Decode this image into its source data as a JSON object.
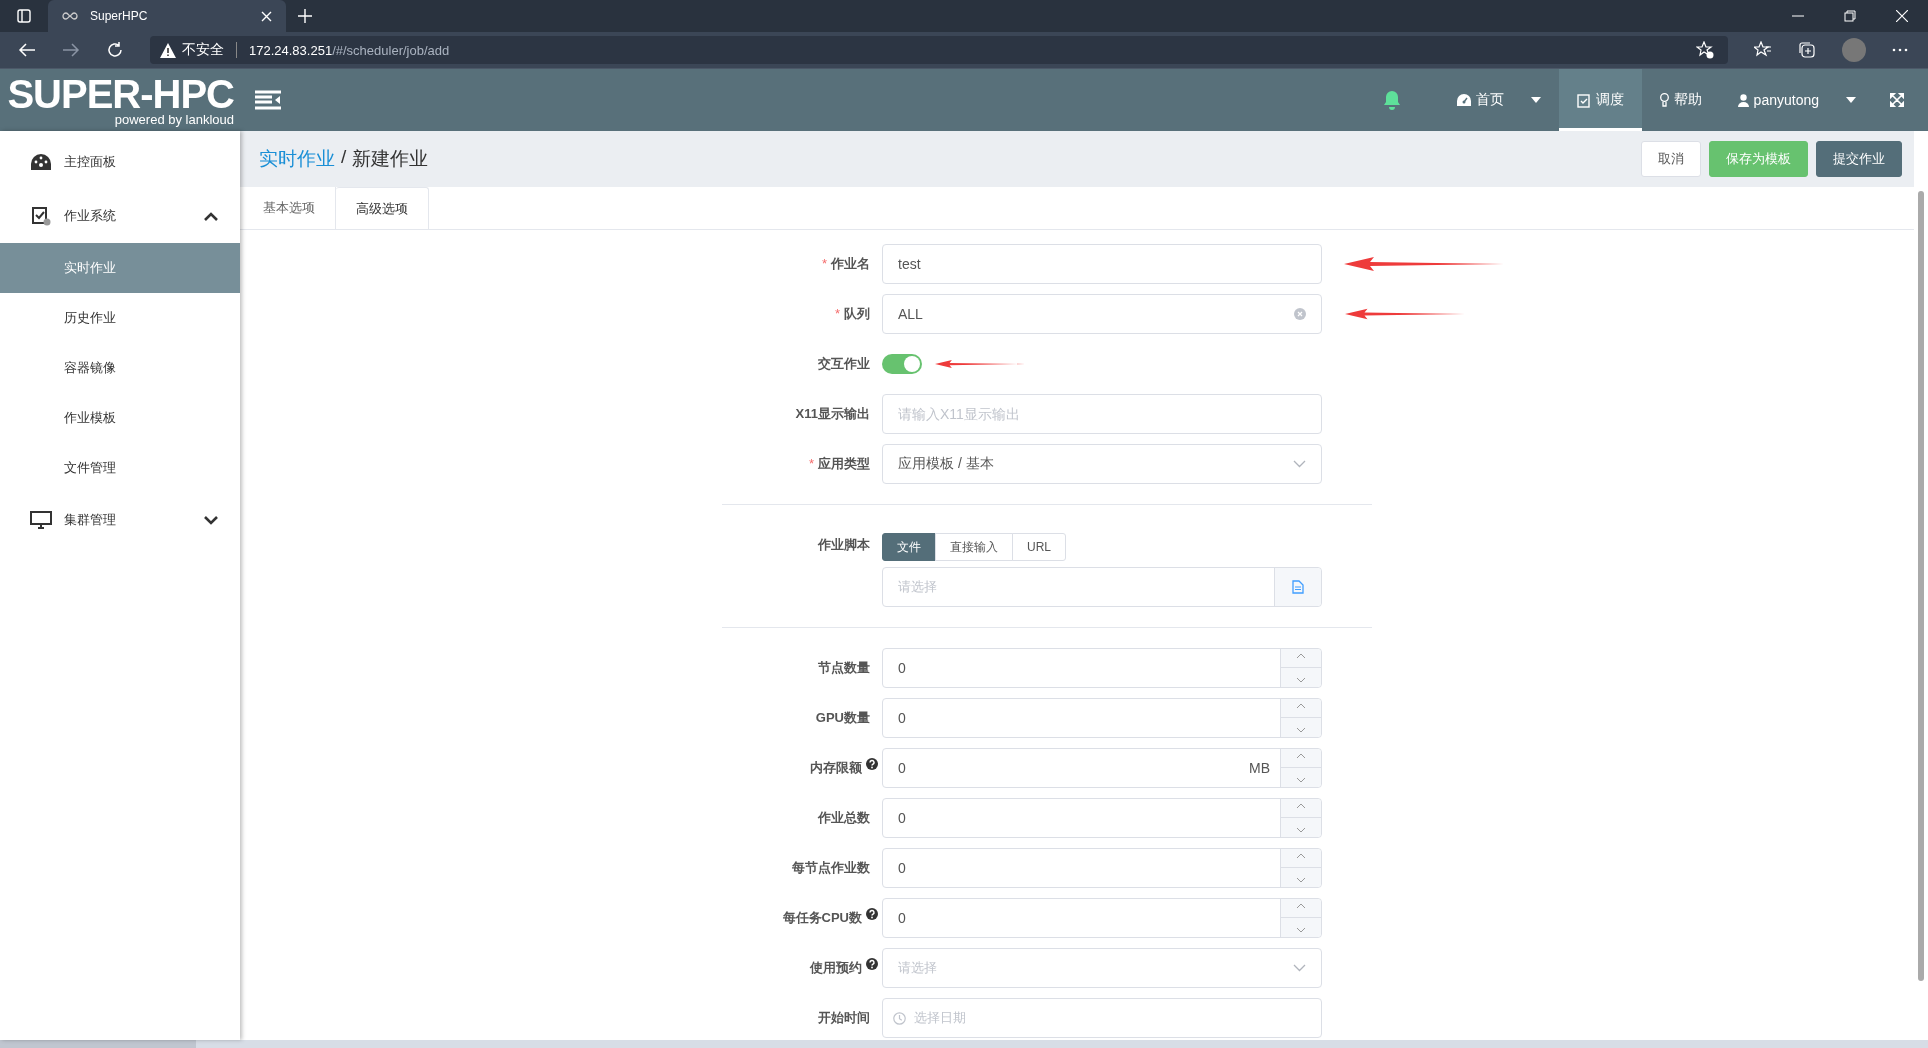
{
  "browser": {
    "tab_title": "SuperHPC",
    "security": "不安全",
    "host": "172.24.83.251",
    "path": "/#/scheduler/job/add"
  },
  "header": {
    "logo": "SUPER-HPC",
    "logo_sub": "powered by lankloud",
    "nav": [
      {
        "kind": "home",
        "label": "首页",
        "selected": false,
        "dropdown": true
      },
      {
        "kind": "schedule",
        "label": "调度",
        "selected": true,
        "dropdown": false
      },
      {
        "kind": "help",
        "label": "帮助",
        "selected": false,
        "dropdown": false
      },
      {
        "kind": "user",
        "label": "panyutong",
        "selected": false,
        "dropdown": true
      }
    ]
  },
  "sidebar": {
    "items": [
      {
        "kind": "dashboard",
        "label": "主控面板"
      },
      {
        "kind": "jobs",
        "label": "作业系统",
        "expanded": true,
        "children": [
          {
            "label": "实时作业",
            "selected": true
          },
          {
            "label": "历史作业",
            "selected": false
          },
          {
            "label": "容器镜像",
            "selected": false
          },
          {
            "label": "作业模板",
            "selected": false
          },
          {
            "label": "文件管理",
            "selected": false
          }
        ]
      },
      {
        "kind": "cluster",
        "label": "集群管理",
        "expanded": false
      }
    ]
  },
  "breadcrumb": {
    "link": "实时作业",
    "separator": "/",
    "current": "新建作业"
  },
  "actions": [
    {
      "kind": "default",
      "label": "取消"
    },
    {
      "kind": "success",
      "label": "保存为模板"
    },
    {
      "kind": "primary",
      "label": "提交作业"
    }
  ],
  "tabs": [
    {
      "label": "基本选项",
      "selected": true
    },
    {
      "label": "高级选项",
      "selected": false
    }
  ],
  "sections": [
    {
      "fields": [
        {
          "kind": "text",
          "label": "作业名",
          "required_mark": "*",
          "value": "test",
          "arrow": true
        },
        {
          "kind": "select",
          "label": "队列",
          "required_mark": "*",
          "value": "ALL",
          "clearable": true,
          "arrow": true
        },
        {
          "kind": "switch",
          "label": "交互作业",
          "on": true,
          "arrow": true
        },
        {
          "kind": "text",
          "label": "X11显示输出",
          "placeholder": "请输入X11显示输出"
        },
        {
          "kind": "select",
          "label": "应用类型",
          "required_mark": "*",
          "value": "应用模板 / 基本"
        }
      ]
    },
    {
      "fields": [
        {
          "kind": "script",
          "label": "作业脚本",
          "options": [
            {
              "label": "文件",
              "selected": true
            },
            {
              "label": "直接输入",
              "selected": false
            },
            {
              "label": "URL",
              "selected": false
            }
          ],
          "placeholder": "请选择"
        }
      ]
    },
    {
      "fields": [
        {
          "kind": "number",
          "label": "节点数量",
          "value": "0"
        },
        {
          "kind": "number",
          "label": "GPU数量",
          "value": "0"
        },
        {
          "kind": "number",
          "label": "内存限额",
          "help": true,
          "value": "0",
          "unit": "MB"
        },
        {
          "kind": "number",
          "label": "作业总数",
          "value": "0"
        },
        {
          "kind": "number",
          "label": "每节点作业数",
          "value": "0"
        },
        {
          "kind": "number",
          "label": "每任务CPU数",
          "help": true,
          "value": "0"
        },
        {
          "kind": "select",
          "label": "使用预约",
          "help": true,
          "placeholder": "请选择"
        },
        {
          "kind": "date",
          "label": "开始时间",
          "placeholder": "选择日期"
        }
      ]
    }
  ]
}
